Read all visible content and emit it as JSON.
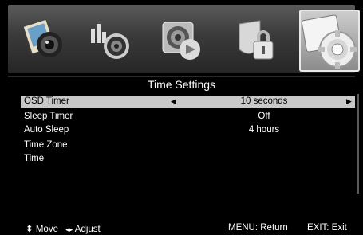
{
  "tabs": [
    {
      "icon": "picture-icon"
    },
    {
      "icon": "sound-icon"
    },
    {
      "icon": "channel-icon"
    },
    {
      "icon": "lock-icon"
    },
    {
      "icon": "settings-gear-icon",
      "active": true
    }
  ],
  "header": {
    "title": "Time Settings"
  },
  "menu": [
    {
      "label": "OSD Timer",
      "value": "10 seconds",
      "selected": true
    },
    {
      "label": "Sleep Timer",
      "value": "Off"
    },
    {
      "label": "Auto Sleep",
      "value": "4 hours"
    },
    {
      "label": "Time Zone",
      "value": ""
    },
    {
      "label": "Time",
      "value": ""
    }
  ],
  "arrows": {
    "left": "◀",
    "right": "▶"
  },
  "footer": {
    "move_icon": "⬍",
    "move": "Move",
    "adjust_icon": "◂▸",
    "adjust": "Adjust",
    "menu_return": "MENU: Return",
    "exit": "EXIT: Exit"
  },
  "colors": {
    "highlight": "#c8c8c8",
    "background": "#000000"
  }
}
